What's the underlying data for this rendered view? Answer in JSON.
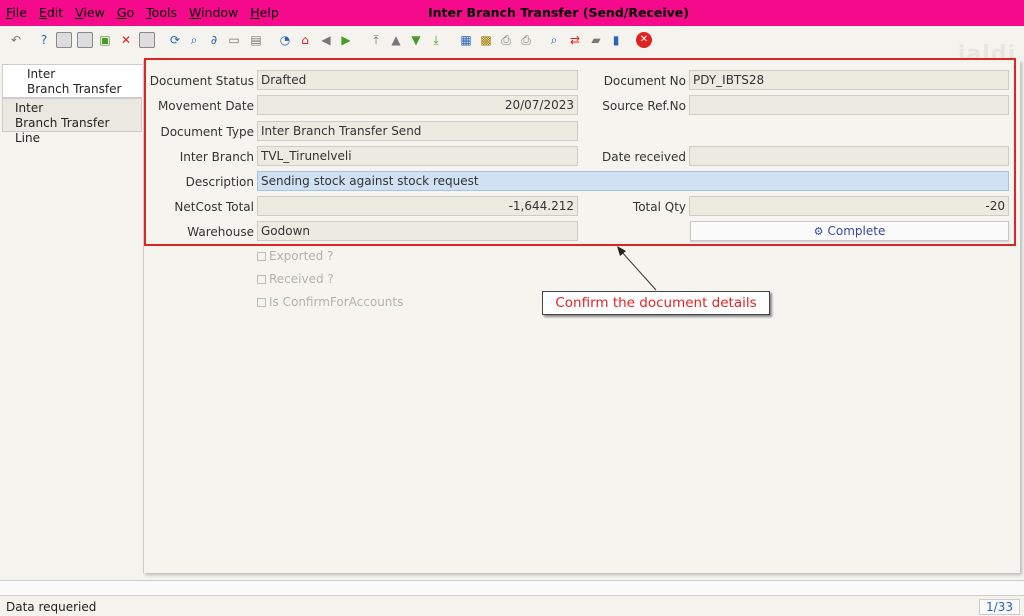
{
  "menu": [
    "File",
    "Edit",
    "View",
    "Go",
    "Tools",
    "Window",
    "Help"
  ],
  "window_title": "Inter Branch Transfer (Send/Receive)",
  "watermark": "jaldi",
  "tabs": [
    {
      "line1": "Inter",
      "line2": "Branch Transfer"
    },
    {
      "line1": "Inter",
      "line2": "Branch Transfer Line"
    }
  ],
  "form": {
    "document_status": {
      "label": "Document Status",
      "value": "Drafted"
    },
    "document_no": {
      "label": "Document No",
      "value": "PDY_IBTS28"
    },
    "movement_date": {
      "label": "Movement Date",
      "value": "20/07/2023"
    },
    "source_ref": {
      "label": "Source Ref.No",
      "value": ""
    },
    "document_type": {
      "label": "Document Type",
      "value": "Inter Branch Transfer Send"
    },
    "inter_branch": {
      "label": "Inter Branch",
      "value": "TVL_Tirunelveli"
    },
    "date_received": {
      "label": "Date received",
      "value": ""
    },
    "description": {
      "label": "Description",
      "value": "Sending stock against stock request"
    },
    "netcost_total": {
      "label": "NetCost Total",
      "value": "-1,644.212"
    },
    "total_qty": {
      "label": "Total Qty",
      "value": "-20"
    },
    "warehouse": {
      "label": "Warehouse",
      "value": "Godown"
    },
    "complete_button": "Complete"
  },
  "checkboxes": [
    "Exported ?",
    "Received ?",
    "Is ConfirmForAccounts"
  ],
  "annotation": "Confirm the document details",
  "status": {
    "text": "Data requeried",
    "pager": "1/33"
  },
  "colors": {
    "title_bar": "#f50a8c",
    "highlight": "#e02424",
    "description_bg": "#cfe1f3"
  }
}
